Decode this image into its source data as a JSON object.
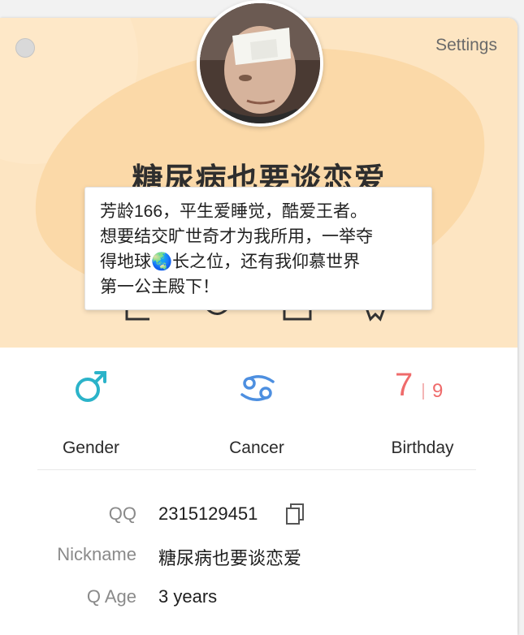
{
  "header": {
    "settings_label": "Settings",
    "display_name": "糖尿病也要谈恋爱",
    "bio": "芳龄166，平生爱睡觉，酷爱王者。\n想要结交旷世奇才为我所用，一举夺\n得地球🌏长之位，还有我仰慕世界\n第一公主殿下！"
  },
  "stats": {
    "gender": {
      "label": "Gender",
      "icon": "male-icon",
      "color": "#2bb3c9"
    },
    "zodiac": {
      "label": "Cancer",
      "icon": "cancer-zodiac-icon",
      "color": "#4d8fe0"
    },
    "birthday": {
      "label": "Birthday",
      "month": "7",
      "day": "9",
      "color": "#ef6b6b"
    }
  },
  "info": {
    "qq_label": "QQ",
    "qq_value": "2315129451",
    "nickname_label": "Nickname",
    "nickname_value": "糖尿病也要谈恋爱",
    "qage_label": "Q Age",
    "qage_value": "3 years"
  }
}
